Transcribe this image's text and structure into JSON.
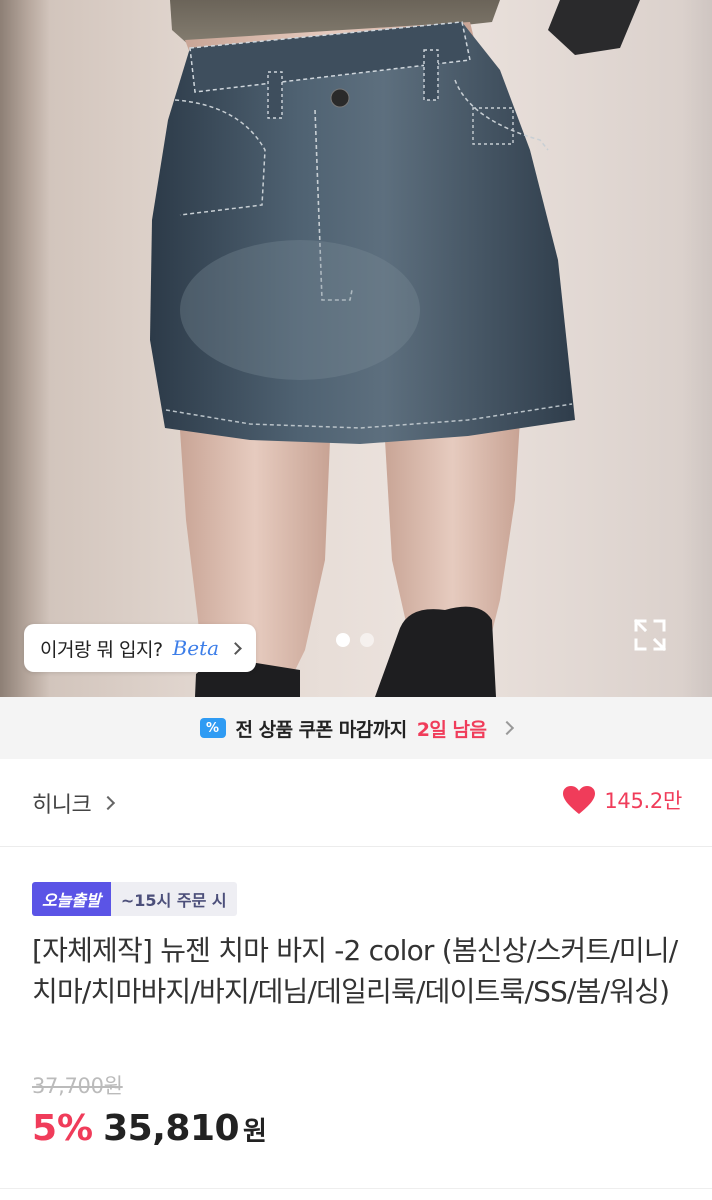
{
  "product_image": {
    "ai_prompt": {
      "question": "이거랑 뭐 입지?",
      "beta_label": "Beta"
    },
    "carousel": {
      "total": 2,
      "current": 1
    },
    "expand_icon": "expand-icon"
  },
  "coupon_banner": {
    "icon": "coupon-percent-icon",
    "text": "전 상품 쿠폰 마감까지",
    "remaining": "2일 남음"
  },
  "seller": {
    "name": "히니크"
  },
  "likes": {
    "icon": "heart-icon",
    "count": "145.2만",
    "color": "#f03c5a"
  },
  "badges": {
    "delivery": "오늘출발",
    "deadline": "~15시 주문 시"
  },
  "product": {
    "title": "[자체제작] 뉴젠 치마 바지 -2 color (봄신상/스커트/미니/치마/치마바지/바지/데님/데일리룩/데이트룩/SS/봄/워싱)",
    "original_price": "37,700원",
    "discount": "5%",
    "price": "35,810",
    "currency": "원"
  },
  "colors": {
    "accent_red": "#f03c5a",
    "badge_purple": "#5b54e6",
    "coupon_blue": "#2f9bf3"
  }
}
